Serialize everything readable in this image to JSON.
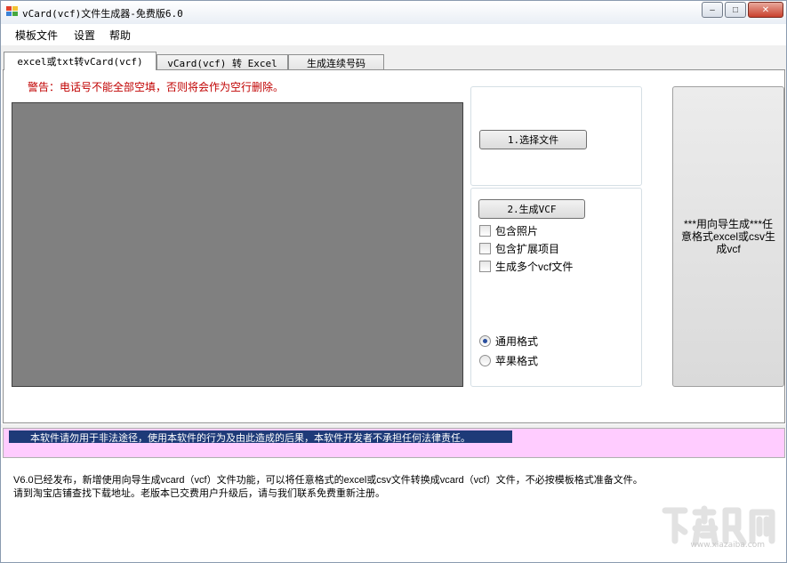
{
  "window": {
    "title": "vCard(vcf)文件生成器-免费版6.0",
    "minimize_symbol": "–",
    "maximize_symbol": "□",
    "close_symbol": "✕"
  },
  "menu": {
    "items": [
      "模板文件",
      "设置",
      "帮助"
    ]
  },
  "tabs": [
    {
      "label": "excel或txt转vCard(vcf)",
      "active": true
    },
    {
      "label": "vCard(vcf) 转 Excel",
      "active": false
    },
    {
      "label": "生成连续号码",
      "active": false
    }
  ],
  "main": {
    "warning": "警告：电话号不能全部空填，否则将会作为空行删除。",
    "select_file_button": "1.选择文件",
    "generate_button": "2.生成VCF",
    "options": [
      {
        "label": "包含照片",
        "checked": false
      },
      {
        "label": "包含扩展项目",
        "checked": false
      },
      {
        "label": "生成多个vcf文件",
        "checked": false
      }
    ],
    "formats": [
      {
        "label": "通用格式",
        "checked": true
      },
      {
        "label": "苹果格式",
        "checked": false
      }
    ],
    "wizard_button": "***用向导生成***任意格式excel或csv生成vcf"
  },
  "disclaimer": "本软件请勿用于非法途径，使用本软件的行为及由此造成的后果，本软件开发者不承担任何法律责任。",
  "notice": {
    "line1": "V6.0已经发布，新增使用向导生成vcard（vcf）文件功能，可以将任意格式的excel或csv文件转换成vcard（vcf）文件，不必按模板格式准备文件。",
    "line2": "请到淘宝店铺查找下载地址。老版本已交费用户升级后，请与我们联系免费重新注册。"
  },
  "watermark": {
    "site": "www.xiazaiba.com"
  },
  "colors": {
    "warning": "#c00000",
    "disclaimer_bg": "#ffccff",
    "selection": "#1e3a78",
    "panel_gray": "#808080"
  }
}
